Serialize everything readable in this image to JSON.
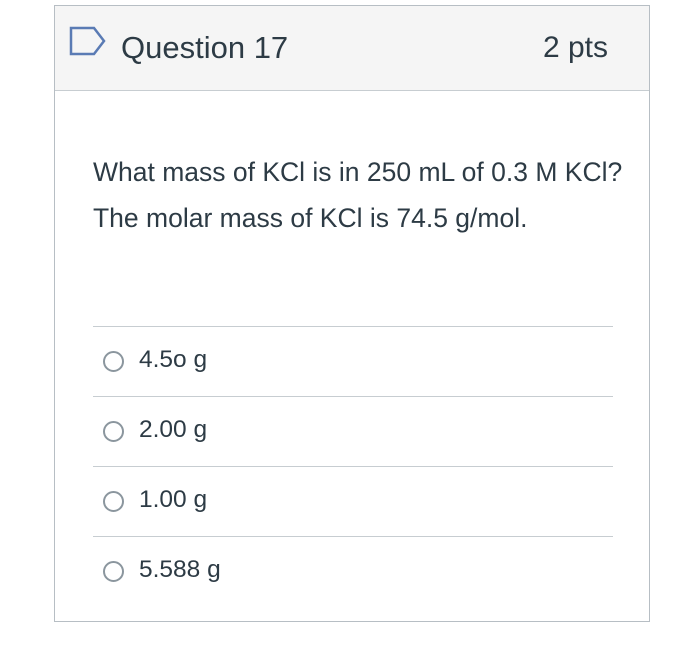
{
  "question": {
    "title": "Question 17",
    "points": "2 pts",
    "flag_icon": "flag-outline-icon",
    "text": "What mass of KCl is in 250 mL of 0.3 M KCl?  The molar mass of KCl is 74.5 g/mol."
  },
  "answers": [
    {
      "label": "4.5o g",
      "selected": false
    },
    {
      "label": "2.00 g",
      "selected": false
    },
    {
      "label": "1.00 g",
      "selected": false
    },
    {
      "label": "5.588 g",
      "selected": false
    }
  ],
  "colors": {
    "text": "#2d3b45",
    "border": "#b7bec4",
    "header_bg": "#f5f5f5",
    "flag": "#5a7bb4",
    "radio_border": "#8b969e"
  }
}
